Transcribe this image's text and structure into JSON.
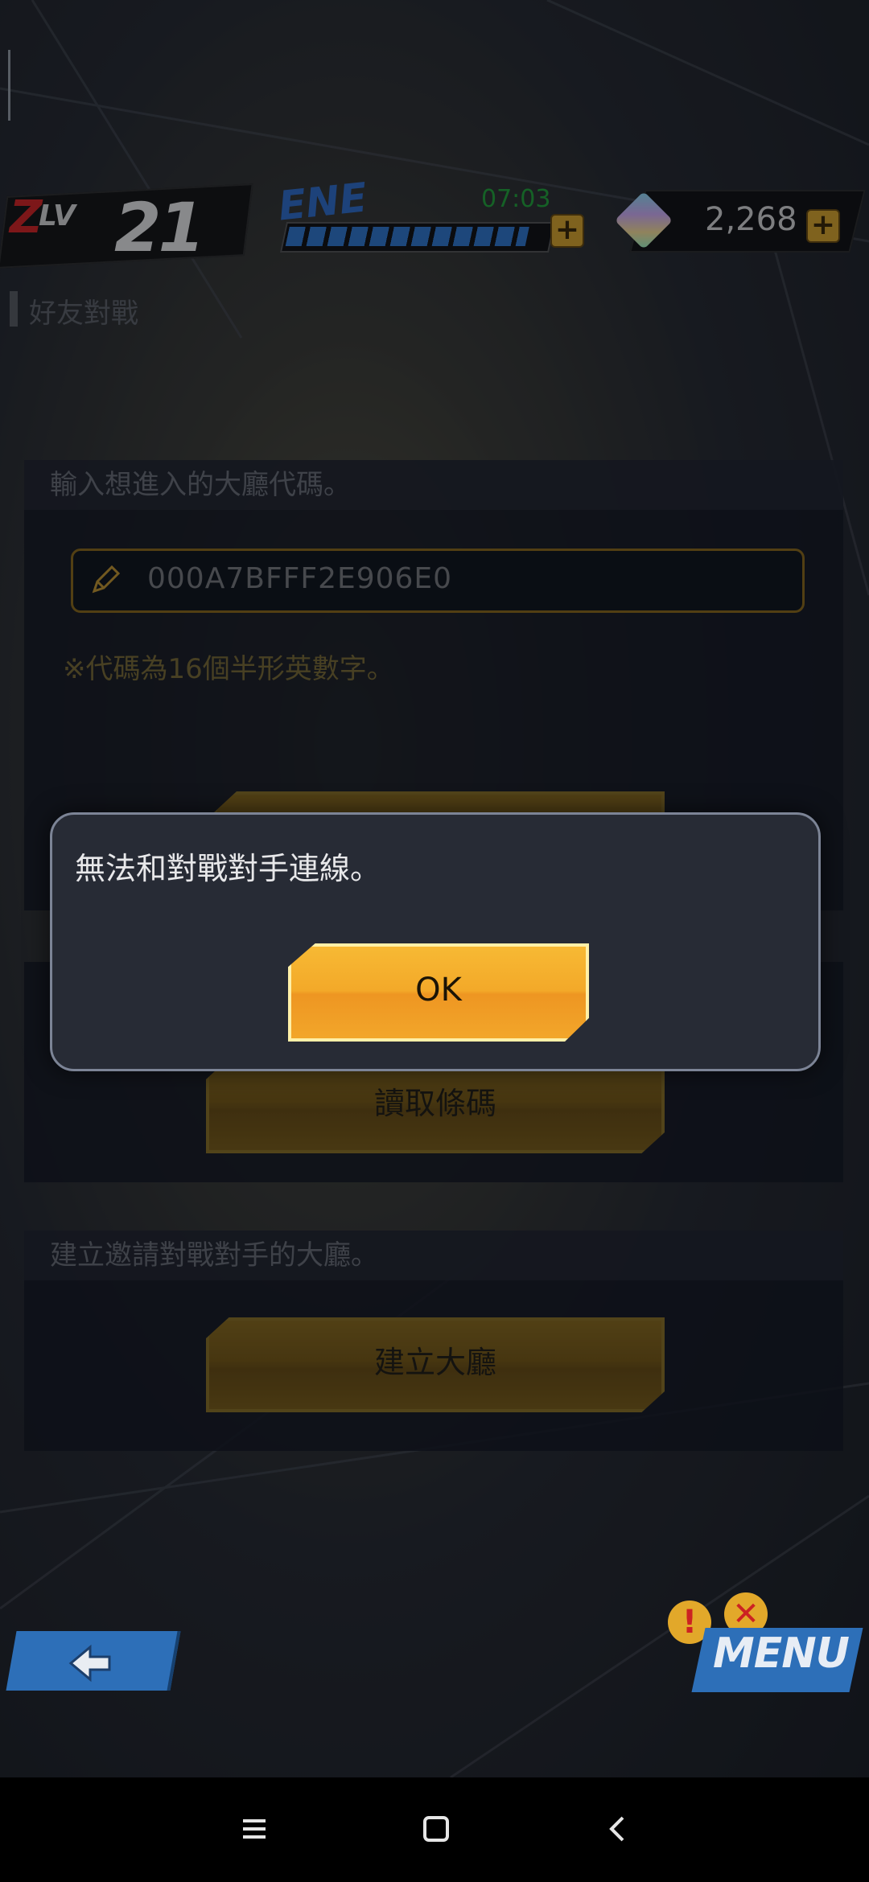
{
  "hud": {
    "level_prefix": "Z",
    "level_label": "LV",
    "level_value": "21",
    "energy_label": "ENE",
    "energy_timer": "07:03",
    "energy_fill_fraction": 0.93,
    "gems_count": "2,268"
  },
  "page": {
    "title": "好友對戰"
  },
  "join_panel": {
    "heading": "輸入想進入的大廳代碼。",
    "code_value": "000A7BFFF2E906E0",
    "note": "※代碼為16個半形英數字。"
  },
  "barcode_panel": {
    "button_label": "讀取條碼"
  },
  "create_panel": {
    "heading": "建立邀請對戰對手的大廳。",
    "button_label": "建立大廳"
  },
  "dialog": {
    "message": "無法和對戰對手連線。",
    "ok_label": "OK"
  },
  "menu": {
    "label": "MENU"
  },
  "colors": {
    "accent_gold": "#f3a929",
    "energy_blue": "#2e78d4",
    "timer_green": "#1fa83a",
    "level_red": "#dd2222"
  },
  "icons": [
    "pencil-icon",
    "plus-icon",
    "gem-icon",
    "back-arrow-icon",
    "menu-lines-icon",
    "home-square-icon",
    "back-chevron-icon"
  ]
}
